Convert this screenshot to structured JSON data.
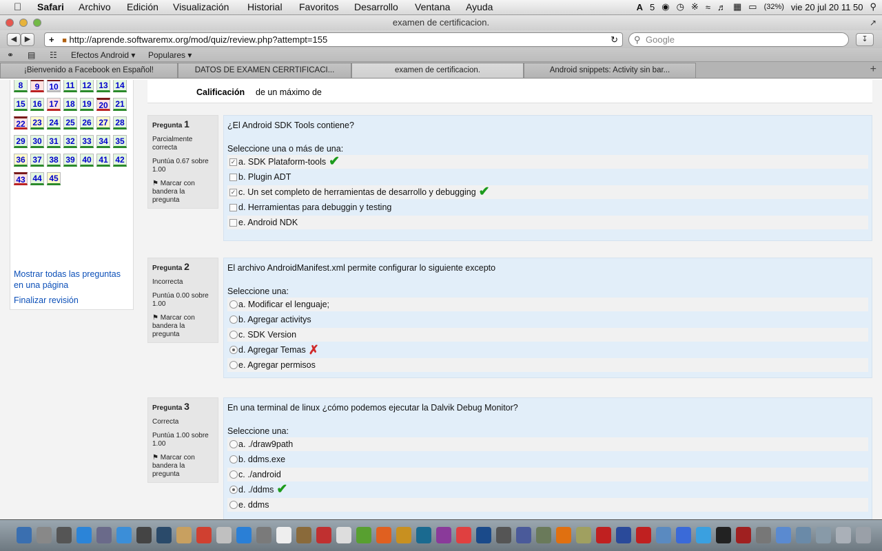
{
  "menubar": {
    "app": "Safari",
    "items": [
      "Archivo",
      "Edición",
      "Visualización",
      "Historial",
      "Favoritos",
      "Desarrollo",
      "Ventana",
      "Ayuda"
    ],
    "status": {
      "adobe_count": "5",
      "battery": "(32%)",
      "clock": "vie 20 jul  20 11 50"
    }
  },
  "window": {
    "title": "examen de certificacion."
  },
  "toolbar": {
    "url": "http://aprende.softwaremx.org/mod/quiz/review.php?attempt=155",
    "search_placeholder": "Google"
  },
  "bookmarks": {
    "items": [
      "Efectos Android",
      "Populares"
    ]
  },
  "tabs": [
    {
      "label": "¡Bienvenido a Facebook en Español!"
    },
    {
      "label": "DATOS DE EXAMEN CERRTIFICACI..."
    },
    {
      "label": "examen de certificacion."
    },
    {
      "label": "Android snippets: Activity sin bar..."
    }
  ],
  "quiz_nav": {
    "numbers": [
      "8",
      "9",
      "10",
      "11",
      "12",
      "13",
      "14",
      "15",
      "16",
      "17",
      "18",
      "19",
      "20",
      "21",
      "22",
      "23",
      "24",
      "25",
      "26",
      "27",
      "28",
      "29",
      "30",
      "31",
      "32",
      "33",
      "34",
      "35",
      "36",
      "37",
      "38",
      "39",
      "40",
      "41",
      "42",
      "43",
      "44",
      "45"
    ],
    "show_all": "Mostrar todas las preguntas en una página",
    "finish": "Finalizar revisión"
  },
  "summary": {
    "label": "Calificación",
    "value": "de un máximo de"
  },
  "questions": [
    {
      "label": "Pregunta",
      "number": "1",
      "state": "Parcialmente correcta",
      "score": "Puntúa 0.67 sobre 1.00",
      "flag": "Marcar con bandera la pregunta",
      "text": "¿El Android SDK Tools contiene?",
      "prompt": "Seleccione una o más de una:",
      "answers": [
        "a. SDK Plataform-tools",
        "b. Plugin ADT",
        "c. Un set completo de herramientas de desarrollo y debugging",
        "d. Herramientas para debuggin y testing",
        "e. Android NDK"
      ]
    },
    {
      "label": "Pregunta",
      "number": "2",
      "state": "Incorrecta",
      "score": "Puntúa 0.00 sobre 1.00",
      "flag": "Marcar con bandera la pregunta",
      "text": "El archivo AndroidManifest.xml permite configurar lo siguiente excepto",
      "prompt": "Seleccione una:",
      "answers": [
        "a. Modificar el lenguaje;",
        "b. Agregar activitys",
        "c. SDK Version",
        "d. Agregar Temas",
        "e. Agregar permisos"
      ]
    },
    {
      "label": "Pregunta",
      "number": "3",
      "state": "Correcta",
      "score": "Puntúa 1.00 sobre 1.00",
      "flag": "Marcar con bandera la pregunta",
      "text": "En una terminal de linux ¿cómo podemos ejecutar la Dalvik Debug Monitor?",
      "prompt": "Seleccione una:",
      "answers": [
        "a. ./draw9path",
        "b. ddms.exe",
        "c. ./android",
        "d. ./ddms",
        "e. ddms"
      ]
    }
  ],
  "colors": {
    "correct": "#1c9b1c",
    "incorrect": "#d02a2a",
    "link": "#0b4fb8",
    "question_bg": "#e2eef9"
  }
}
